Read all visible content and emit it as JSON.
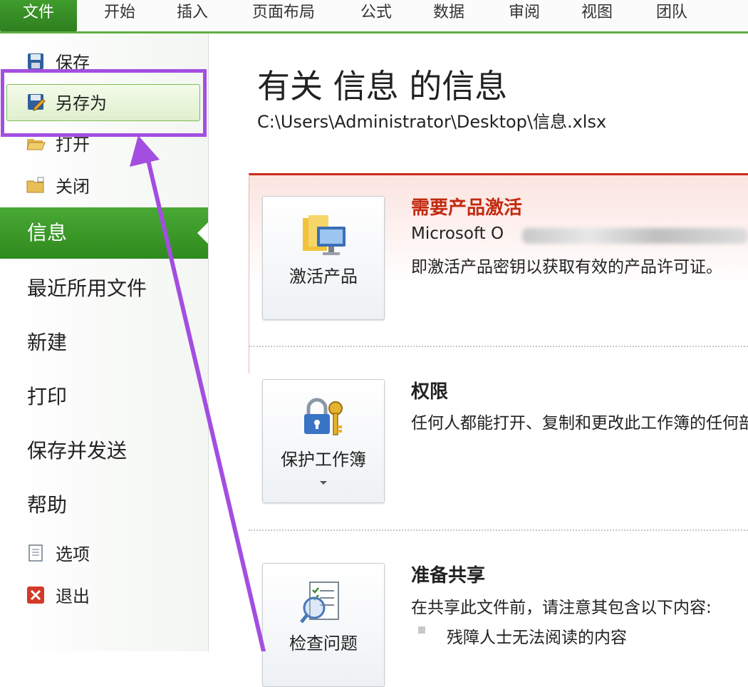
{
  "ribbon": {
    "tabs": [
      "文件",
      "开始",
      "插入",
      "页面布局",
      "公式",
      "数据",
      "审阅",
      "视图",
      "团队"
    ]
  },
  "sidebar": {
    "commands": {
      "save": "保存",
      "save_as": "另存为",
      "open": "打开",
      "close": "关闭"
    },
    "nav": {
      "info": "信息",
      "recent": "最近所用文件",
      "new": "新建",
      "print": "打印",
      "save_send": "保存并发送",
      "help": "帮助"
    },
    "bottom": {
      "options": "选项",
      "exit": "退出"
    }
  },
  "main": {
    "title": "有关 信息 的信息",
    "path": "C:\\Users\\Administrator\\Desktop\\信息.xlsx",
    "activation": {
      "button_label": "激活产品",
      "heading": "需要产品激活",
      "line1": "Microsoft O",
      "line2": "即激活产品密钥以获取有效的产品许可证。"
    },
    "permissions": {
      "button_label": "保护工作簿",
      "heading": "权限",
      "text": "任何人都能打开、复制和更改此工作簿的任何部分。"
    },
    "prepare": {
      "button_label": "检查问题",
      "heading": "准备共享",
      "text": "在共享此文件前，请注意其包含以下内容:",
      "bullet1": "残障人士无法阅读的内容"
    }
  },
  "colors": {
    "accent_green": "#2e8a1d",
    "activation_red": "#c22a10",
    "annotation_purple": "#a34ee0"
  }
}
